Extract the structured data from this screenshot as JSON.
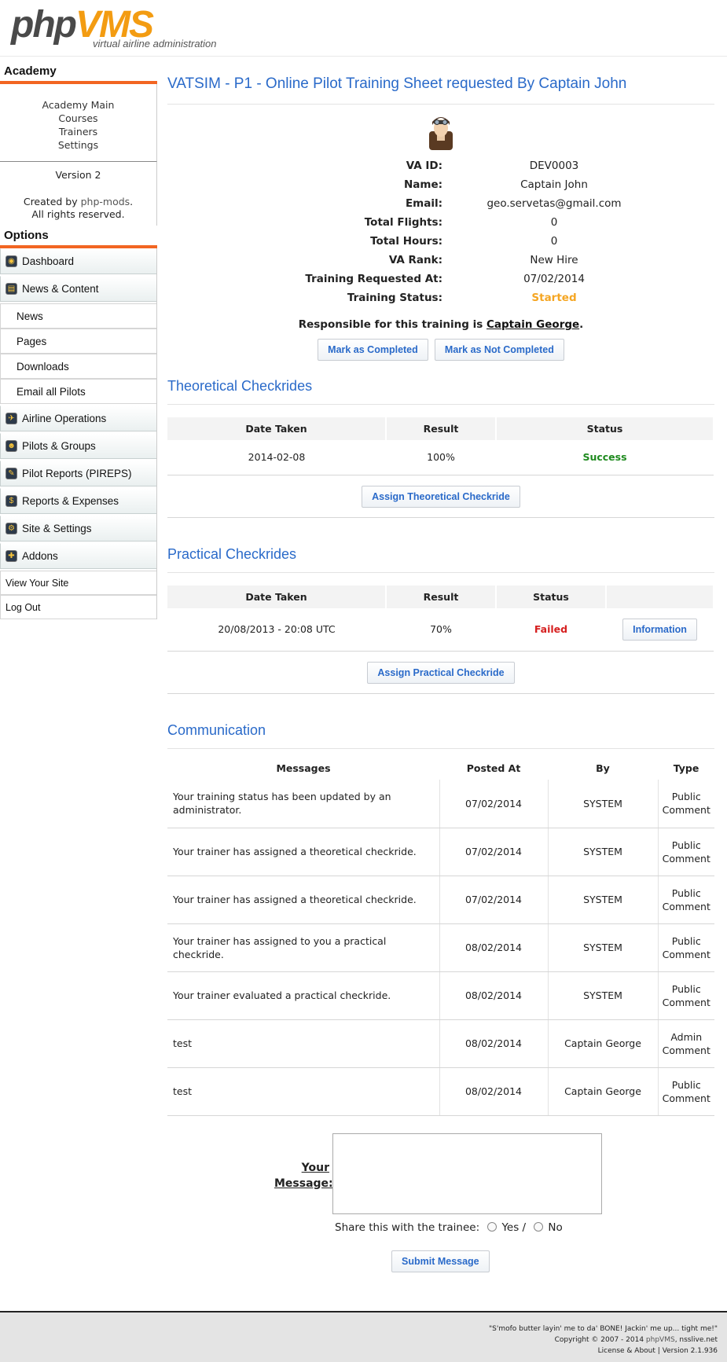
{
  "header": {
    "logo_php": "php",
    "logo_vms": "VMS",
    "tagline": "virtual airline administration"
  },
  "sidebar": {
    "academy_title": "Academy",
    "academy_links": [
      "Academy Main",
      "Courses",
      "Trainers",
      "Settings"
    ],
    "version": "Version 2",
    "created_by_prefix": "Created by ",
    "created_by_link": "php-mods",
    "created_by_suffix": ".",
    "rights": "All rights reserved.",
    "options_title": "Options",
    "menu": {
      "dashboard": "Dashboard",
      "news_content": "News & Content",
      "news": "News",
      "pages": "Pages",
      "downloads": "Downloads",
      "email_pilots": "Email all Pilots",
      "airline_ops": "Airline Operations",
      "pilots_groups": "Pilots & Groups",
      "pireps": "Pilot Reports (PIREPS)",
      "reports_expenses": "Reports & Expenses",
      "site_settings": "Site & Settings",
      "addons": "Addons",
      "view_site": "View Your Site",
      "logout": "Log Out"
    }
  },
  "main": {
    "title": "VATSIM - P1 - Online Pilot Training Sheet requested By Captain John",
    "info": [
      {
        "label": "VA ID:",
        "value": "DEV0003"
      },
      {
        "label": "Name:",
        "value": "Captain John"
      },
      {
        "label": "Email:",
        "value": "geo.servetas@gmail.com"
      },
      {
        "label": "Total Flights:",
        "value": "0"
      },
      {
        "label": "Total Hours:",
        "value": "0"
      },
      {
        "label": "VA Rank:",
        "value": "New Hire"
      },
      {
        "label": "Training Requested At:",
        "value": "07/02/2014"
      },
      {
        "label": "Training Status:",
        "value": "Started"
      }
    ],
    "responsible_prefix": "Responsible for this training is ",
    "responsible_name": "Captain George",
    "responsible_suffix": ".",
    "btn_completed": "Mark as Completed",
    "btn_not_completed": "Mark as Not Completed",
    "theoretical": {
      "title": "Theoretical Checkrides",
      "headers": [
        "Date Taken",
        "Result",
        "Status"
      ],
      "rows": [
        {
          "date": "2014-02-08",
          "result": "100%",
          "status": "Success"
        }
      ],
      "assign_btn": "Assign Theoretical Checkride"
    },
    "practical": {
      "title": "Practical Checkrides",
      "headers": [
        "Date Taken",
        "Result",
        "Status",
        ""
      ],
      "rows": [
        {
          "date": "20/08/2013 - 20:08 UTC",
          "result": "70%",
          "status": "Failed",
          "action": "Information"
        }
      ],
      "assign_btn": "Assign Practical Checkride"
    },
    "communication": {
      "title": "Communication",
      "headers": [
        "Messages",
        "Posted At",
        "By",
        "Type"
      ],
      "rows": [
        {
          "message": "Your training status has been updated by an administrator.",
          "posted": "07/02/2014",
          "by": "SYSTEM",
          "type": "Public Comment"
        },
        {
          "message": "Your trainer has assigned a theoretical checkride.",
          "posted": "07/02/2014",
          "by": "SYSTEM",
          "type": "Public Comment"
        },
        {
          "message": "Your trainer has assigned a theoretical checkride.",
          "posted": "07/02/2014",
          "by": "SYSTEM",
          "type": "Public Comment"
        },
        {
          "message": "Your trainer has assigned to you a practical checkride.",
          "posted": "08/02/2014",
          "by": "SYSTEM",
          "type": "Public Comment"
        },
        {
          "message": "Your trainer evaluated a practical checkride.",
          "posted": "08/02/2014",
          "by": "SYSTEM",
          "type": "Public Comment"
        },
        {
          "message": "test",
          "posted": "08/02/2014",
          "by": "Captain George",
          "type": "Admin Comment"
        },
        {
          "message": "test",
          "posted": "08/02/2014",
          "by": "Captain George",
          "type": "Public Comment"
        }
      ],
      "message_label": "Your Message:",
      "message_value": "",
      "share_label": "Share this with the trainee:",
      "share_yes": "Yes /",
      "share_no": "No",
      "submit": "Submit Message"
    }
  },
  "footer": {
    "quote": "\"S'mofo butter layin' me to da' BONE! Jackin' me up... tight me!\"",
    "copyright_prefix": "Copyright © 2007 - 2014 ",
    "copyright_brand": "phpVMS",
    "copyright_suffix": ", nsslive.net",
    "links": "License & About",
    "version": "Version 2.1.936"
  }
}
